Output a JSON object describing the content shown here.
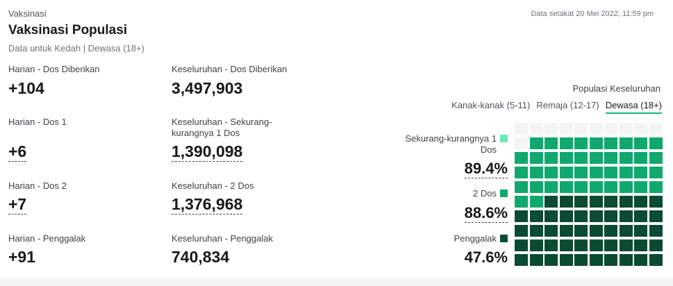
{
  "header": {
    "section": "Vaksinasi",
    "title": "Vaksinasi Populasi",
    "subtitle": "Data untuk Kedah | Dewasa (18+)",
    "timestamp": "Data setakat 20 Mei 2022, 11:59 pm"
  },
  "daily": [
    {
      "label": "Harian - Dos Diberikan",
      "value": "+104"
    },
    {
      "label": "Harian - Dos 1",
      "value": "+6"
    },
    {
      "label": "Harian - Dos 2",
      "value": "+7"
    },
    {
      "label": "Harian - Penggalak",
      "value": "+91"
    }
  ],
  "overall": [
    {
      "label": "Keseluruhan - Dos Diberikan",
      "value": "3,497,903"
    },
    {
      "label": "Keseluruhan - Sekurang-kurangnya 1 Dos",
      "value": "1,390,098"
    },
    {
      "label": "Keseluruhan - 2 Dos",
      "value": "1,376,968"
    },
    {
      "label": "Keseluruhan - Penggalak",
      "value": "740,834"
    }
  ],
  "population": {
    "header": "Populasi Keseluruhan",
    "tabs": [
      "Kanak-kanak (5-11)",
      "Remaja (12-17)",
      "Dewasa (18+)"
    ],
    "active_tab": 2,
    "legend": [
      {
        "label": "Sekurang-kurangnya 1 Dos",
        "pct": "89.4%",
        "fraction": 0.894,
        "color": "#6ee7b7"
      },
      {
        "label": "2 Dos",
        "pct": "88.6%",
        "fraction": 0.886,
        "color": "#10a86f"
      },
      {
        "label": "Penggalak",
        "pct": "47.6%",
        "fraction": 0.476,
        "color": "#0b4a33"
      }
    ],
    "empty_color": "#f4f4f5"
  }
}
